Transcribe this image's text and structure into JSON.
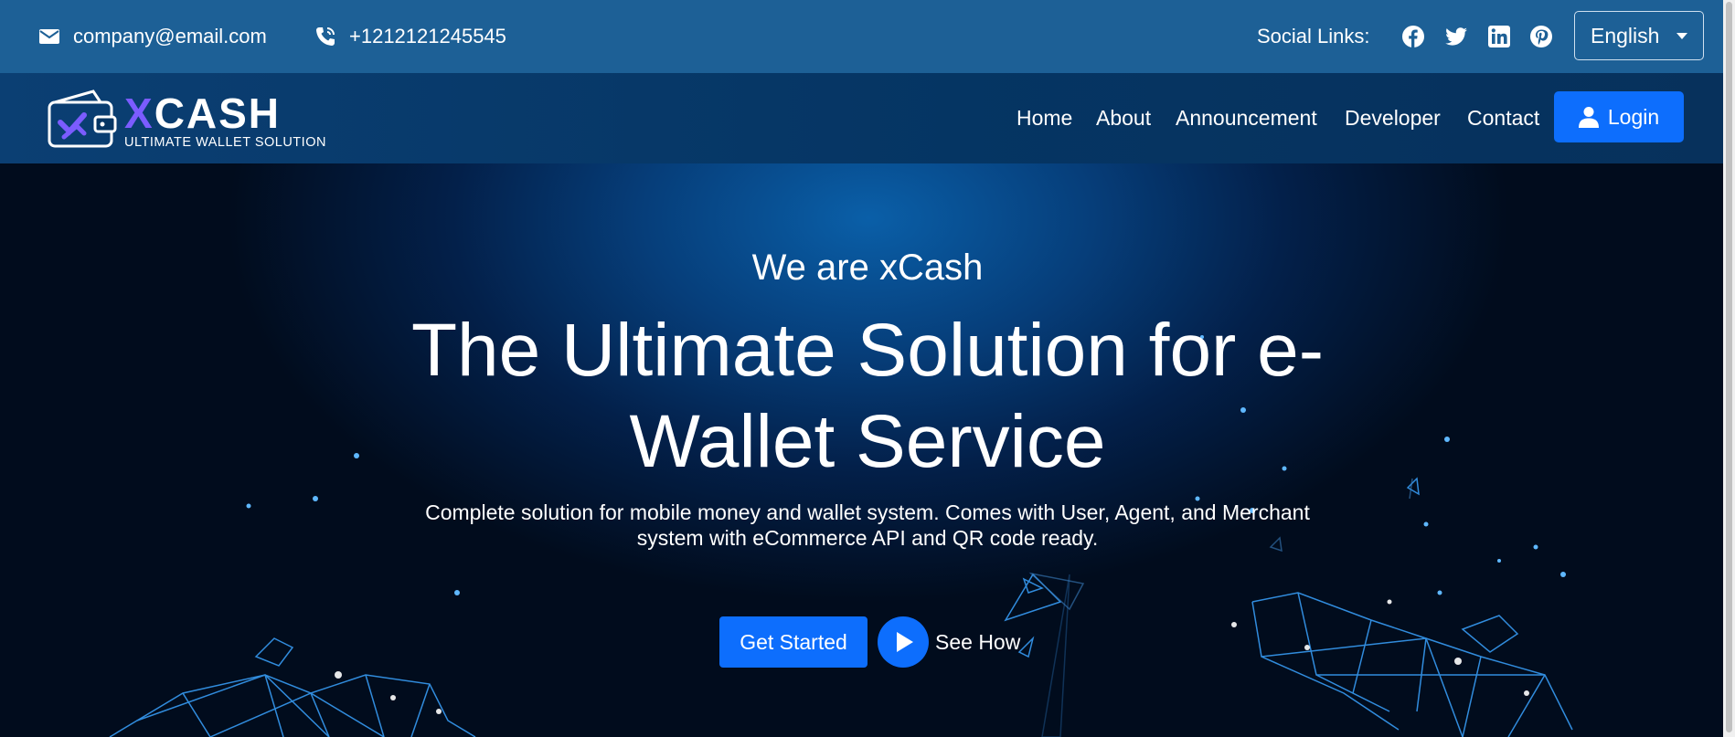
{
  "topbar": {
    "email": "company@email.com",
    "phone": "+1212121245545",
    "social_label": "Social Links:",
    "social_icons": [
      "facebook-icon",
      "twitter-icon",
      "linkedin-icon",
      "pinterest-icon"
    ],
    "language": "English",
    "background": "#1d6096"
  },
  "brand": {
    "name": "XCASH",
    "tagline": "ULTIMATE WALLET SOLUTION",
    "accent": "#7b5cff"
  },
  "nav": {
    "links": [
      "Home",
      "About",
      "Announcement",
      "Developer",
      "Contact"
    ],
    "login_label": "Login",
    "background": "#053563"
  },
  "hero": {
    "eyebrow": "We are xCash",
    "headline_line1": "The Ultimate Solution for e-",
    "headline_line2": "Wallet Service",
    "subtext_line1": "Complete solution for mobile money and wallet system. Comes with User, Agent, and Merchant",
    "subtext_line2": "system with eCommerce API and QR code ready.",
    "primary_button": "Get Started",
    "secondary_button": "See How",
    "button_color": "#0d6efd"
  }
}
